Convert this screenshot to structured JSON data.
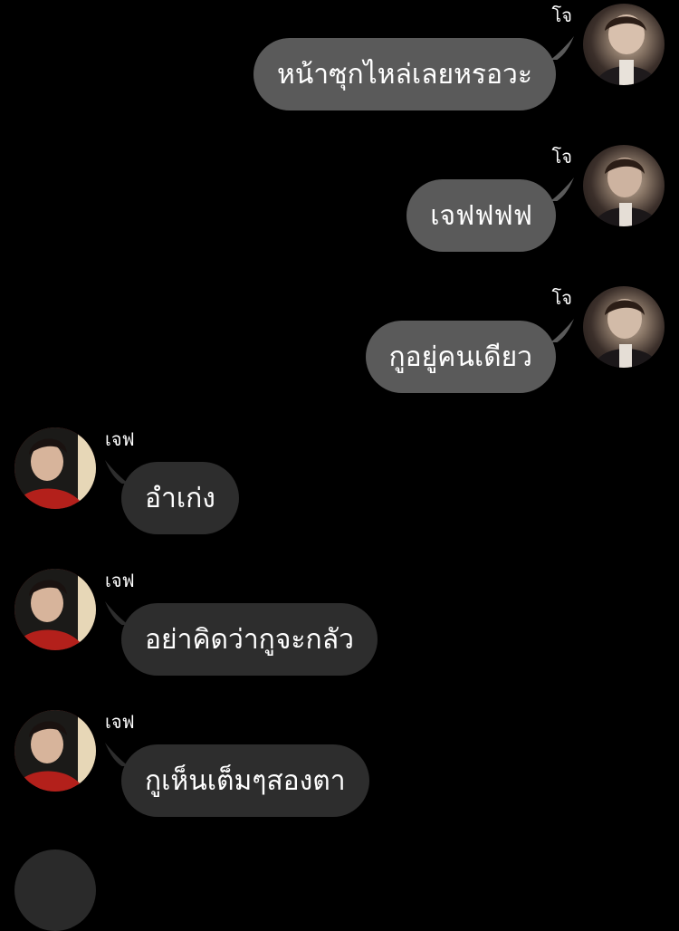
{
  "chat": {
    "messages": [
      {
        "direction": "out",
        "sender": "โจ",
        "text": "หน้าซุกไหล่เลยหรอวะ",
        "avatar_icon": "user-avatar-icon"
      },
      {
        "direction": "out",
        "sender": "โจ",
        "text": "เจฟฟฟฟ",
        "avatar_icon": "user-avatar-icon"
      },
      {
        "direction": "out",
        "sender": "โจ",
        "text": "กูอยู่คนเดียว",
        "avatar_icon": "user-avatar-icon"
      },
      {
        "direction": "in",
        "sender": "เจฟ",
        "text": "อำเก่ง",
        "avatar_icon": "user-avatar-icon"
      },
      {
        "direction": "in",
        "sender": "เจฟ",
        "text": "อย่าคิดว่ากูจะกลัว",
        "avatar_icon": "user-avatar-icon"
      },
      {
        "direction": "in",
        "sender": "เจฟ",
        "text": "กูเห็นเต็มๆสองตา",
        "avatar_icon": "user-avatar-icon"
      }
    ]
  },
  "colors": {
    "background": "#000000",
    "outgoing_bubble": "#5a5a5a",
    "incoming_bubble": "#2d2d2d",
    "text": "#ffffff"
  }
}
